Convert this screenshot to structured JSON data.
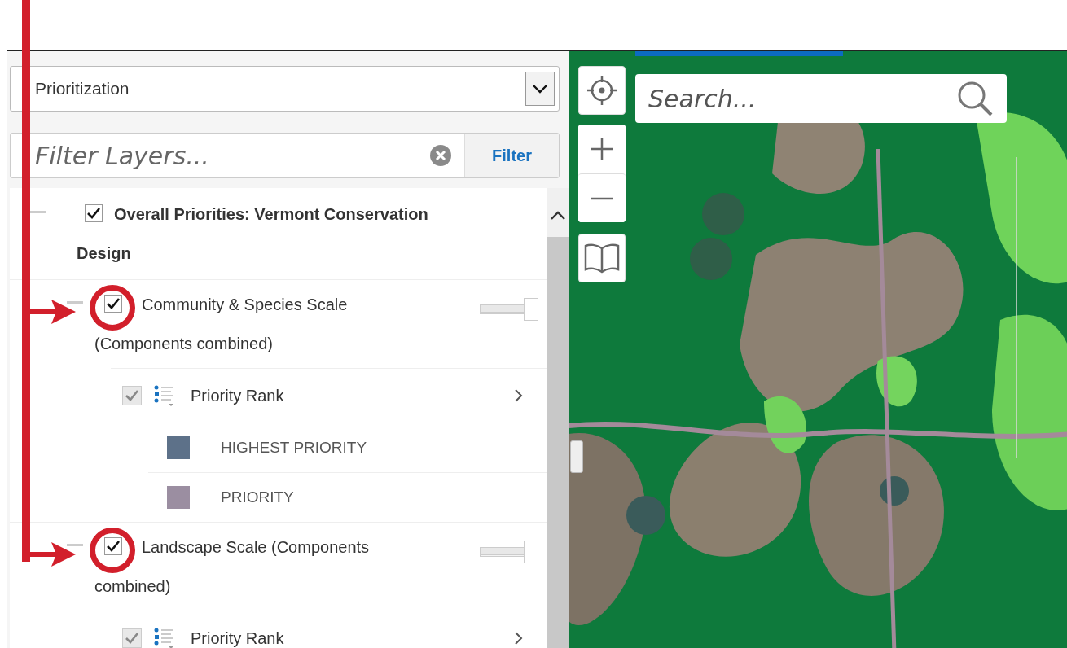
{
  "dropdown": {
    "value": "Prioritization"
  },
  "filter": {
    "placeholder": "Filter Layers...",
    "button": "Filter"
  },
  "layers": [
    {
      "label": "Overall Priorities: Vermont Conservation Design",
      "checked": true,
      "expanded": true,
      "annotated": false,
      "children": [
        {
          "label": "Community & Species Scale (Components combined)",
          "checked": true,
          "expanded": true,
          "annotated": true,
          "level": 1,
          "sublayers": [
            {
              "label": "Priority Rank",
              "checked": true,
              "legend": [
                {
                  "label": "HIGHEST PRIORITY",
                  "color": "#5d7189"
                },
                {
                  "label": "PRIORITY",
                  "color": "#9b8ea1"
                }
              ]
            }
          ]
        },
        {
          "label": "Landscape Scale (Components combined)",
          "checked": true,
          "expanded": true,
          "annotated": true,
          "level": 1,
          "sublayers": [
            {
              "label": "Priority Rank",
              "checked": true
            }
          ]
        }
      ]
    }
  ],
  "map": {
    "search_placeholder": "Search..."
  }
}
